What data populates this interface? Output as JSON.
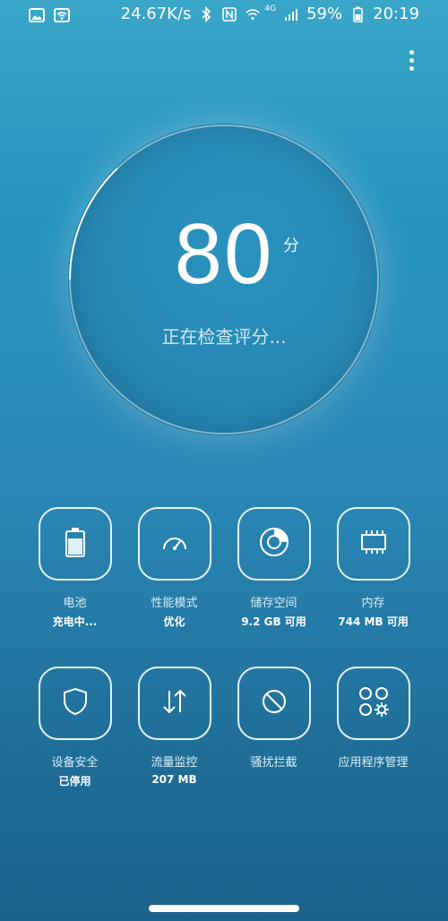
{
  "status_bar": {
    "net_speed": "24.67K/s",
    "network_label": "4G",
    "battery": "59%",
    "time": "20:19"
  },
  "score": {
    "value": "80",
    "unit": "分",
    "status": "正在检查评分..."
  },
  "tiles": [
    {
      "label": "电池",
      "sub": "充电中...",
      "icon": "battery-icon"
    },
    {
      "label": "性能模式",
      "sub": "优化",
      "icon": "speedometer-icon"
    },
    {
      "label": "储存空间",
      "sub": "9.2 GB 可用",
      "icon": "storage-icon"
    },
    {
      "label": "内存",
      "sub": "744 MB 可用",
      "icon": "memory-chip-icon"
    },
    {
      "label": "设备安全",
      "sub": "已停用",
      "icon": "shield-icon"
    },
    {
      "label": "流量监控",
      "sub": "207 MB",
      "icon": "data-traffic-icon"
    },
    {
      "label": "骚扰拦截",
      "sub": "",
      "icon": "block-icon"
    },
    {
      "label": "应用程序管理",
      "sub": "",
      "icon": "app-manager-icon"
    }
  ],
  "colors": {
    "background_top": "#3aa6c9",
    "background_bottom": "#1b628a"
  }
}
